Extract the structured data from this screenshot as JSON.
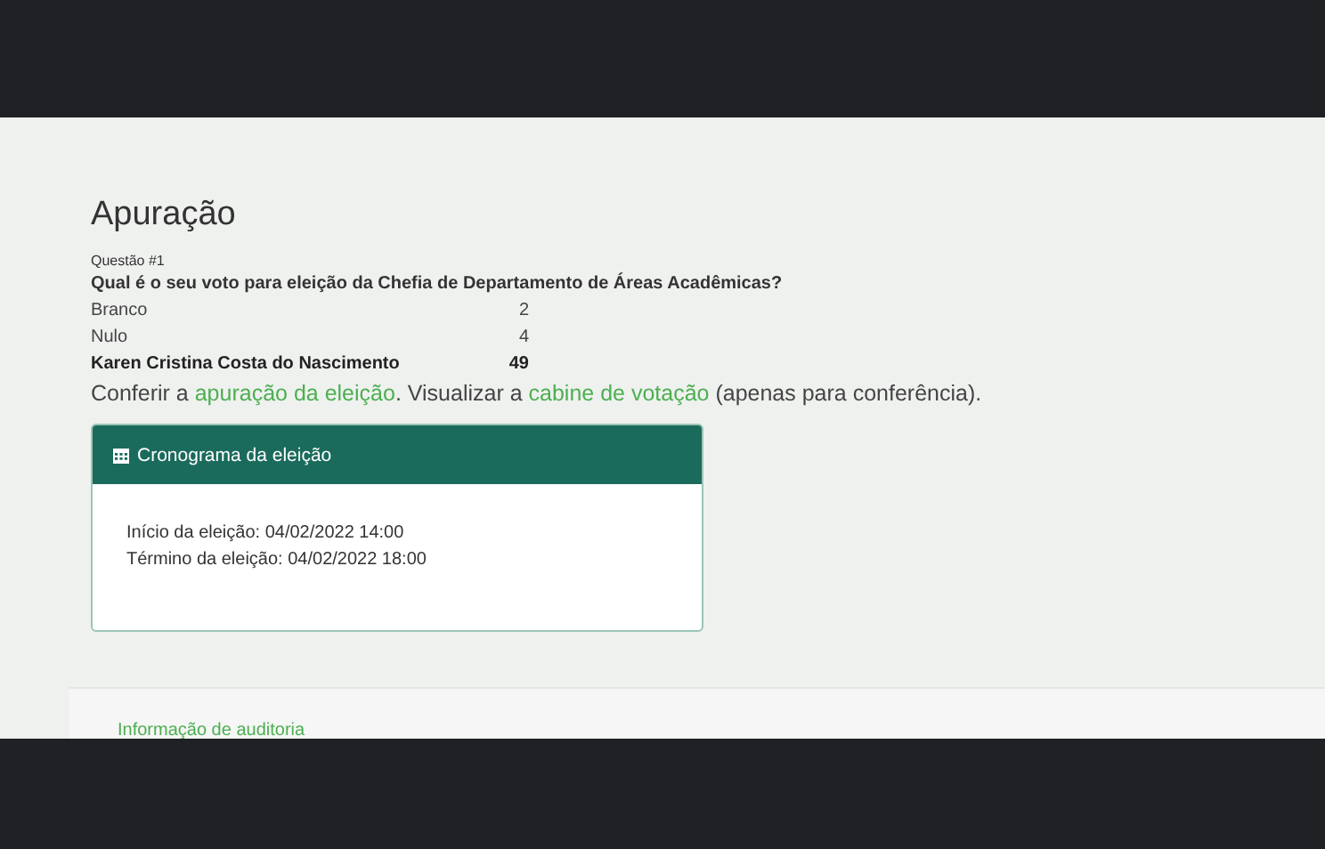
{
  "title": "Apuração",
  "question": {
    "label": "Questão #1",
    "text": "Qual é o seu voto para eleição da Chefia de Departamento de Áreas Acadêmicas?",
    "results": [
      {
        "name": "Branco",
        "votes": "2",
        "winner": false
      },
      {
        "name": "Nulo",
        "votes": "4",
        "winner": false
      },
      {
        "name": "Karen Cristina Costa do Nascimento",
        "votes": "49",
        "winner": true
      }
    ]
  },
  "note": [
    {
      "kind": "text",
      "text": "Conferir a "
    },
    {
      "kind": "link",
      "text": "apuração da eleição"
    },
    {
      "kind": "text",
      "text": ". Visualizar a "
    },
    {
      "kind": "link",
      "text": "cabine de votação"
    },
    {
      "kind": "text",
      "text": " (apenas para conferência)."
    }
  ],
  "schedule": {
    "title": "Cronograma da eleição",
    "lines": [
      "Início da eleição: 04/02/2022 14:00",
      "Término da eleição: 04/02/2022 18:00"
    ]
  },
  "audit": {
    "link": "Informação de auditoria"
  }
}
